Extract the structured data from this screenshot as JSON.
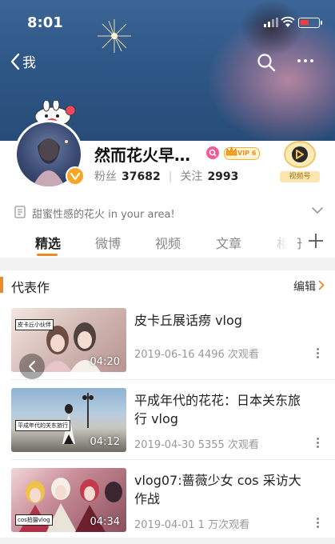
{
  "status_bar": {
    "time": "8:01"
  },
  "nav": {
    "back_label": "我"
  },
  "profile": {
    "name": "然而花火早…",
    "vip_label": "VIP 6",
    "followers_label": "粉丝",
    "followers": "37682",
    "following_label": "关注",
    "following": "2993",
    "video_account_label": "视频号"
  },
  "bio": {
    "text": "甜蜜性感的花火 in your area!"
  },
  "tabs": [
    {
      "label": "精选",
      "active": true
    },
    {
      "label": "微博"
    },
    {
      "label": "视频"
    },
    {
      "label": "文章"
    },
    {
      "label": "相册"
    }
  ],
  "section": {
    "title": "代表作",
    "edit_label": "编辑"
  },
  "videos": [
    {
      "title": "皮卡丘展话痨 vlog",
      "meta": "2019-06-16 4496 次观看",
      "duration": "04:20",
      "tag": "皮卡丘小伙伴"
    },
    {
      "title": "平成年代的花花：日本关东旅行 vlog",
      "meta": "2019-04-30 5355 次观看",
      "duration": "04:12",
      "tag": "平成年代的关东旅行"
    },
    {
      "title": "vlog07:蔷薇少女 cos 采访大作战",
      "meta": "2019-04-01 1 万次观看",
      "duration": "04:34",
      "tag": "cos拍摄vlog"
    }
  ],
  "colors": {
    "accent": "#f08a24",
    "header_bg": "#2e5787",
    "vip_gold": "#f5a623"
  }
}
